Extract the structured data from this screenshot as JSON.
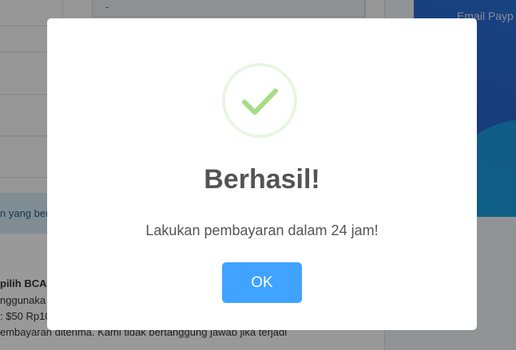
{
  "background": {
    "input_value": "-",
    "notice_text": "n yang ber",
    "instructions": [
      "pilih BCA",
      "nggunaka",
      ": $50 Rp10",
      "embayaran diterima. Kami tidak bertanggung jawab jika terjadi"
    ],
    "right_card_label": "Email Payp"
  },
  "modal": {
    "title": "Berhasil!",
    "message": "Lakukan pembayaran dalam 24 jam!",
    "ok_label": "OK"
  },
  "colors": {
    "overlay": "rgba(0,0,0,0.4)",
    "success_green": "#a5dc86",
    "button_blue": "#3fa3ff",
    "text_gray": "#545454"
  }
}
